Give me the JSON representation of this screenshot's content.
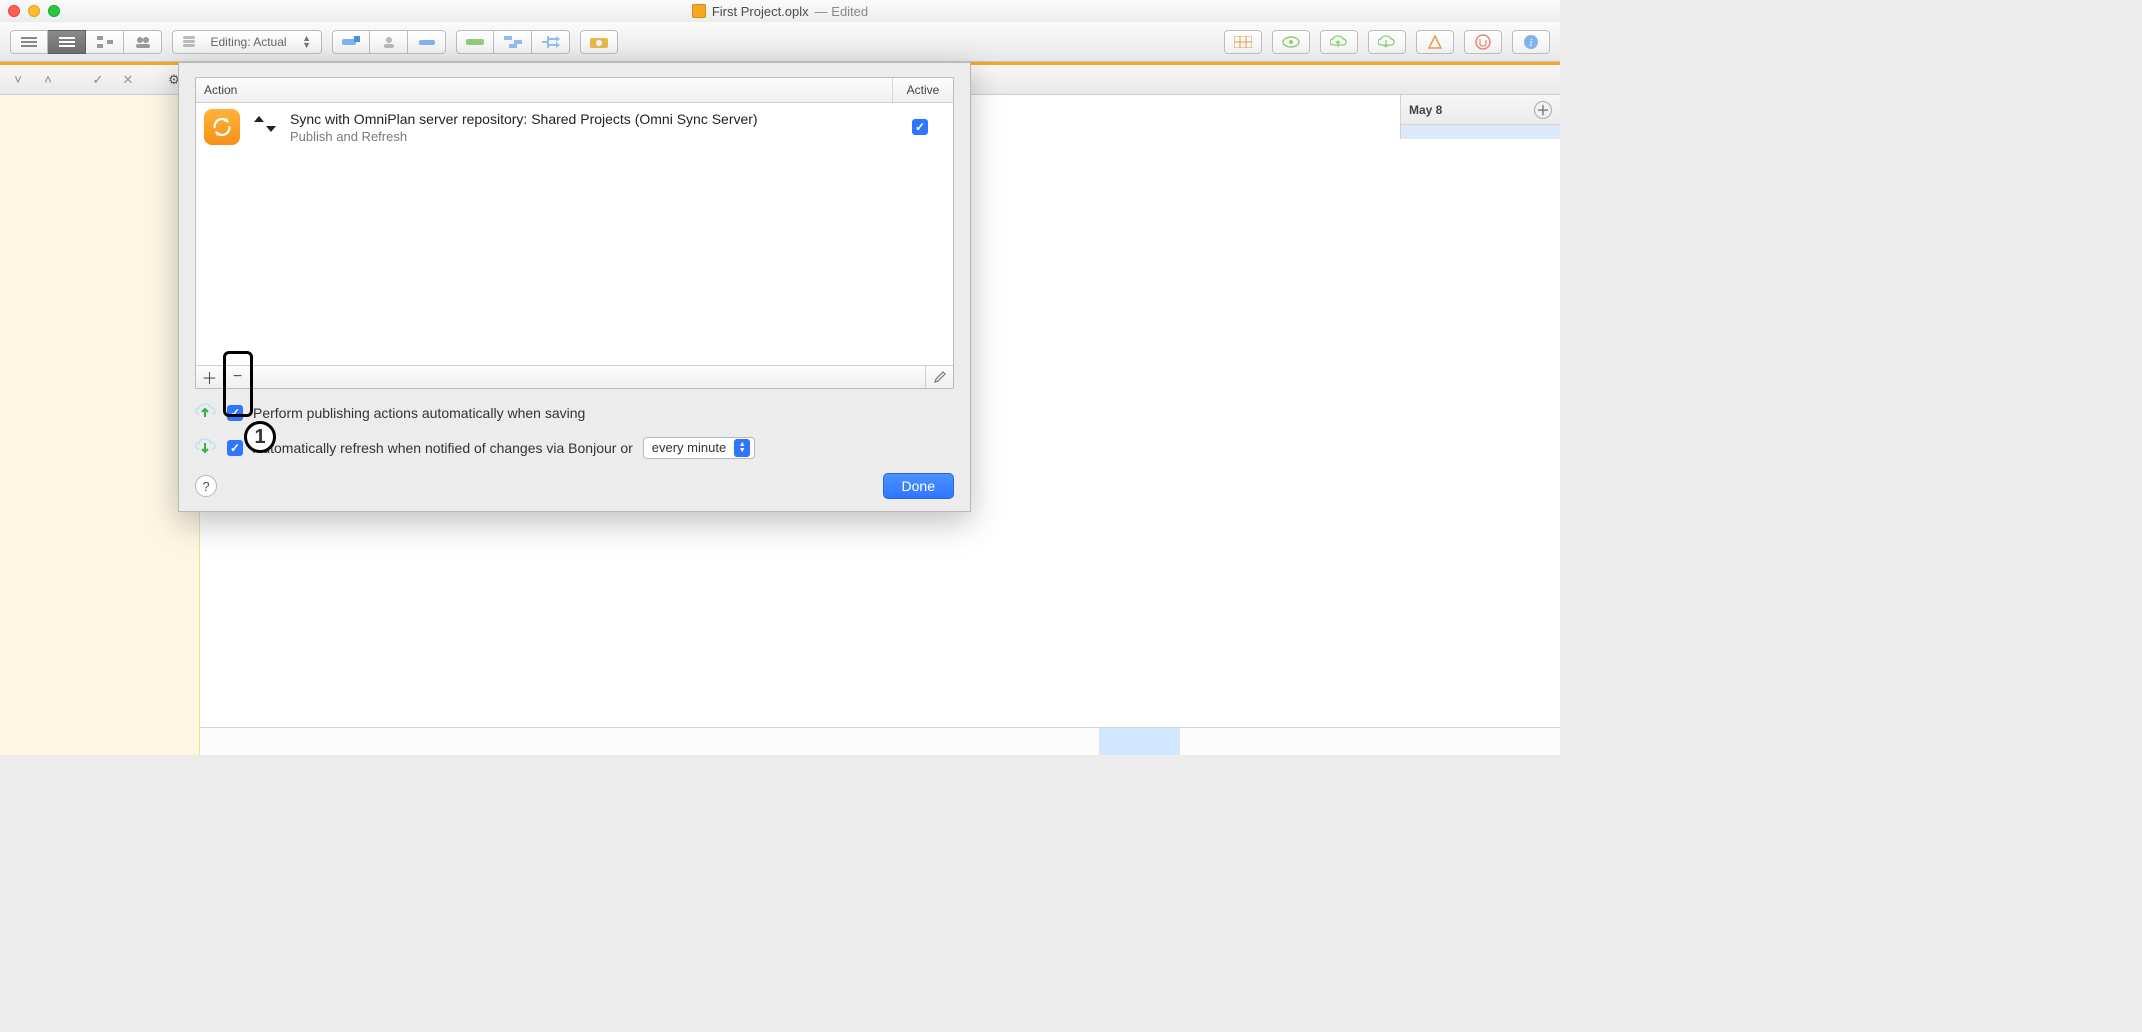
{
  "window": {
    "filename": "First Project.oplx",
    "edited_suffix": "— Edited"
  },
  "toolbar": {
    "mode_label": "Editing: Actual"
  },
  "timeline": {
    "date_label": "May 8"
  },
  "sheet": {
    "columns": {
      "action": "Action",
      "active": "Active"
    },
    "actions": [
      {
        "title": "Sync with OmniPlan server repository: Shared Projects (Omni Sync Server)",
        "subtitle": "Publish and Refresh",
        "active": true
      }
    ],
    "option_publish": "Perform publishing actions automatically when saving",
    "option_refresh": "Automatically refresh when notified of changes via Bonjour or",
    "interval_selected": "every minute",
    "done": "Done",
    "publish_checked": true,
    "refresh_checked": true
  },
  "annotation": {
    "marker": "1"
  }
}
